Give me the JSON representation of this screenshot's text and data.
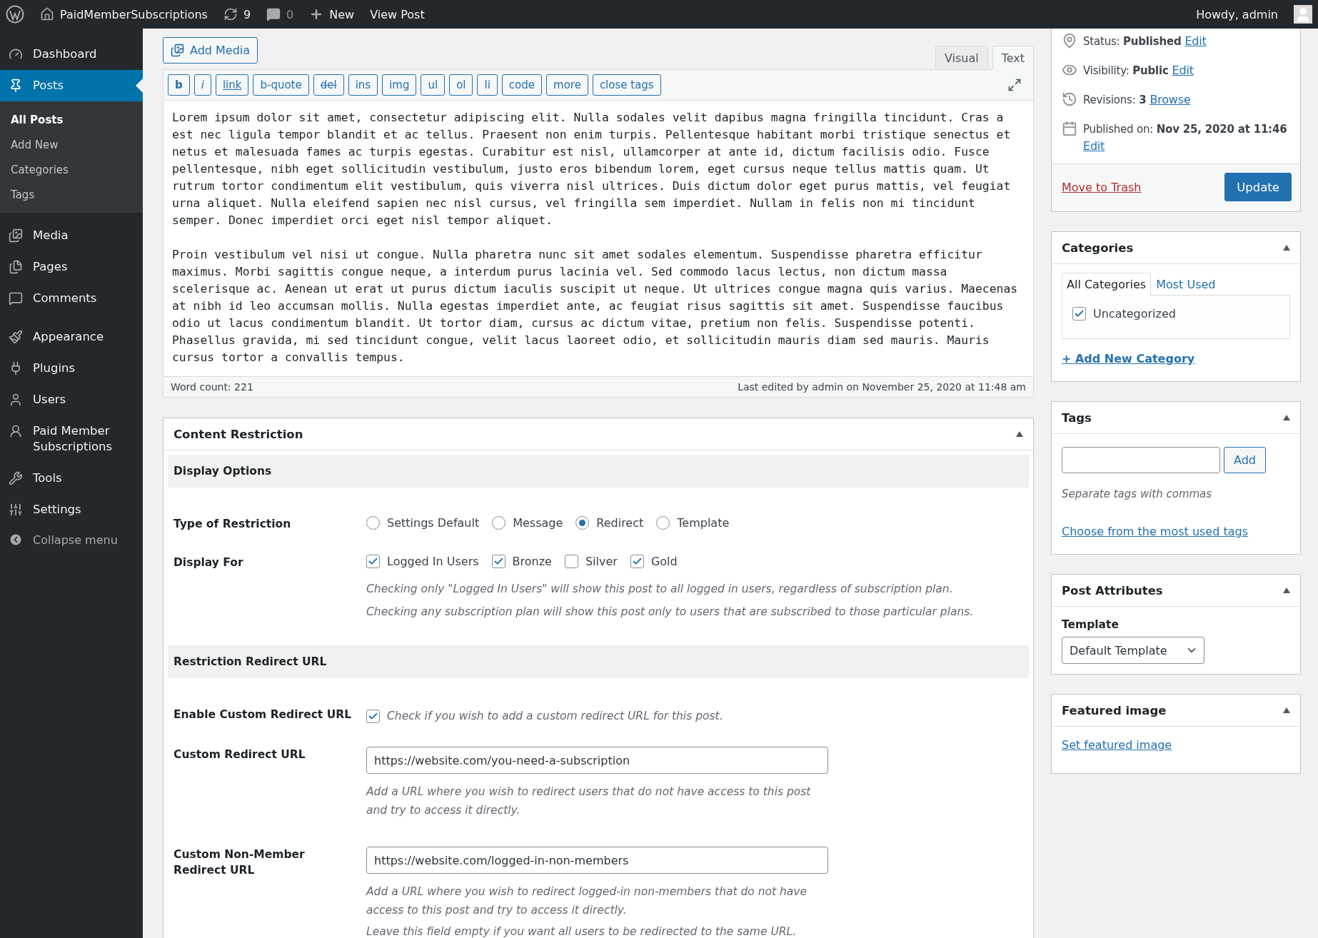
{
  "admin_bar": {
    "site_name": "PaidMemberSubscriptions",
    "updates": "9",
    "comments": "0",
    "new": "New",
    "view": "View Post",
    "greeting": "Howdy, admin"
  },
  "sidebar": {
    "items": [
      {
        "label": "Dashboard",
        "selected": false
      },
      {
        "label": "Posts",
        "selected": true,
        "children": [
          {
            "label": "All Posts",
            "selected": true
          },
          {
            "label": "Add New",
            "selected": false
          },
          {
            "label": "Categories",
            "selected": false
          },
          {
            "label": "Tags",
            "selected": false
          }
        ]
      },
      {
        "label": "Media",
        "selected": false
      },
      {
        "label": "Pages",
        "selected": false
      },
      {
        "label": "Comments",
        "selected": false
      },
      {
        "label": "Appearance",
        "selected": false
      },
      {
        "label": "Plugins",
        "selected": false
      },
      {
        "label": "Users",
        "selected": false
      },
      {
        "label": "Paid Member Subscriptions",
        "selected": false
      },
      {
        "label": "Tools",
        "selected": false
      },
      {
        "label": "Settings",
        "selected": false
      }
    ],
    "collapse": "Collapse menu"
  },
  "editor": {
    "add_media": "Add Media",
    "tabs": [
      {
        "label": "Visual",
        "selected": false
      },
      {
        "label": "Text",
        "selected": true
      }
    ],
    "quicktags": [
      {
        "label": "b",
        "kind": "bold"
      },
      {
        "label": "i",
        "kind": "italic"
      },
      {
        "label": "link",
        "kind": "link"
      },
      {
        "label": "b-quote",
        "kind": "plain"
      },
      {
        "label": "del",
        "kind": "del"
      },
      {
        "label": "ins",
        "kind": "plain"
      },
      {
        "label": "img",
        "kind": "plain"
      },
      {
        "label": "ul",
        "kind": "plain"
      },
      {
        "label": "ol",
        "kind": "plain"
      },
      {
        "label": "li",
        "kind": "plain"
      },
      {
        "label": "code",
        "kind": "plain"
      },
      {
        "label": "more",
        "kind": "plain"
      },
      {
        "label": "close tags",
        "kind": "plain"
      }
    ],
    "paragraphs": [
      "Lorem ipsum dolor sit amet, consectetur adipiscing elit. Nulla sodales velit dapibus magna fringilla tincidunt. Cras a est nec ligula tempor blandit et ac tellus. Praesent non enim turpis. Pellentesque habitant morbi tristique senectus et netus et malesuada fames ac turpis egestas. Curabitur est nisl, ullamcorper at ante id, dictum facilisis odio. Fusce pellentesque, nibh eget sollicitudin vestibulum, justo eros bibendum lorem, eget cursus neque tellus mattis quam. Ut rutrum tortor condimentum elit vestibulum, quis viverra nisl ultrices. Duis dictum dolor eget purus mattis, vel feugiat urna aliquet. Nulla eleifend sapien nec nisl cursus, vel fringilla sem imperdiet. Nullam in felis non mi tincidunt semper. Donec imperdiet orci eget nisl tempor aliquet.",
      "Proin vestibulum vel nisi ut congue. Nulla pharetra nunc sit amet sodales elementum. Suspendisse pharetra efficitur maximus. Morbi sagittis congue neque, a interdum purus lacinia vel. Sed commodo lacus lectus, non dictum massa scelerisque ac. Aenean ut erat ut purus dictum iaculis suscipit ut neque. Ut ultrices congue magna quis varius. Maecenas at nibh id leo accumsan mollis. Nulla egestas imperdiet ante, ac feugiat risus sagittis sit amet. Suspendisse faucibus odio ut lacus condimentum blandit. Ut tortor diam, cursus ac dictum vitae, pretium non felis. Suspendisse potenti. Phasellus gravida, mi sed tincidunt congue, velit lacus laoreet odio, et sollicitudin mauris diam sed mauris. Mauris cursus tortor a convallis tempus."
    ],
    "word_count": "Word count: 221",
    "last_edited": "Last edited by admin on November 25, 2020 at 11:48 am"
  },
  "restriction": {
    "title": "Content Restriction",
    "display_heading": "Display Options",
    "type_label": "Type of Restriction",
    "type_options": [
      {
        "label": "Settings Default",
        "selected": false
      },
      {
        "label": "Message",
        "selected": false
      },
      {
        "label": "Redirect",
        "selected": true
      },
      {
        "label": "Template",
        "selected": false
      }
    ],
    "display_for_label": "Display For",
    "display_for_options": [
      {
        "label": "Logged In Users",
        "checked": true
      },
      {
        "label": "Bronze",
        "checked": true
      },
      {
        "label": "Silver",
        "checked": false
      },
      {
        "label": "Gold",
        "checked": true
      }
    ],
    "display_for_notes": [
      "Checking only \"Logged In Users\" will show this post to all logged in users, regardless of subscription plan.",
      "Checking any subscription plan will show this post only to users that are subscribed to those particular plans."
    ],
    "redirect_heading": "Restriction Redirect URL",
    "enable": {
      "label": "Enable Custom Redirect URL",
      "checked": true,
      "text": "Check if you wish to add a custom redirect URL for this post."
    },
    "url_fields": [
      {
        "label": "Custom Redirect URL",
        "value": "https://website.com/you-need-a-subscription",
        "notes": [
          "Add a URL where you wish to redirect users that do not have access to this post and try to access it directly."
        ]
      },
      {
        "label": "Custom Non-Member Redirect URL",
        "value": "https://website.com/logged-in-non-members",
        "notes": [
          "Add a URL where you wish to redirect logged-in non-members that do not have access to this post and try to access it directly.",
          "Leave this field empty if you want all users to be redirected to the same URL."
        ]
      }
    ]
  },
  "publish": {
    "rows": [
      {
        "text": "Status: **Published**",
        "link": "Edit"
      },
      {
        "text": "Visibility: **Public**",
        "link": "Edit"
      },
      {
        "text": "Revisions: **3**",
        "link": "Browse"
      },
      {
        "text": "Published on: **Nov 25, 2020 at 11:46**",
        "link": "Edit"
      }
    ],
    "trash": "Move to Trash",
    "update": "Update"
  },
  "categories": {
    "title": "Categories",
    "tabs": [
      {
        "label": "All Categories",
        "selected": true
      },
      {
        "label": "Most Used",
        "selected": false
      }
    ],
    "items": [
      {
        "label": "Uncategorized",
        "checked": true
      }
    ],
    "add_link": "+ Add New Category"
  },
  "tags": {
    "title": "Tags",
    "add_button": "Add",
    "hint": "Separate tags with commas",
    "link": "Choose from the most used tags"
  },
  "post_attributes": {
    "title": "Post Attributes",
    "template_label": "Template",
    "template_value": "Default Template"
  },
  "featured_image": {
    "title": "Featured image",
    "link": "Set featured image"
  }
}
